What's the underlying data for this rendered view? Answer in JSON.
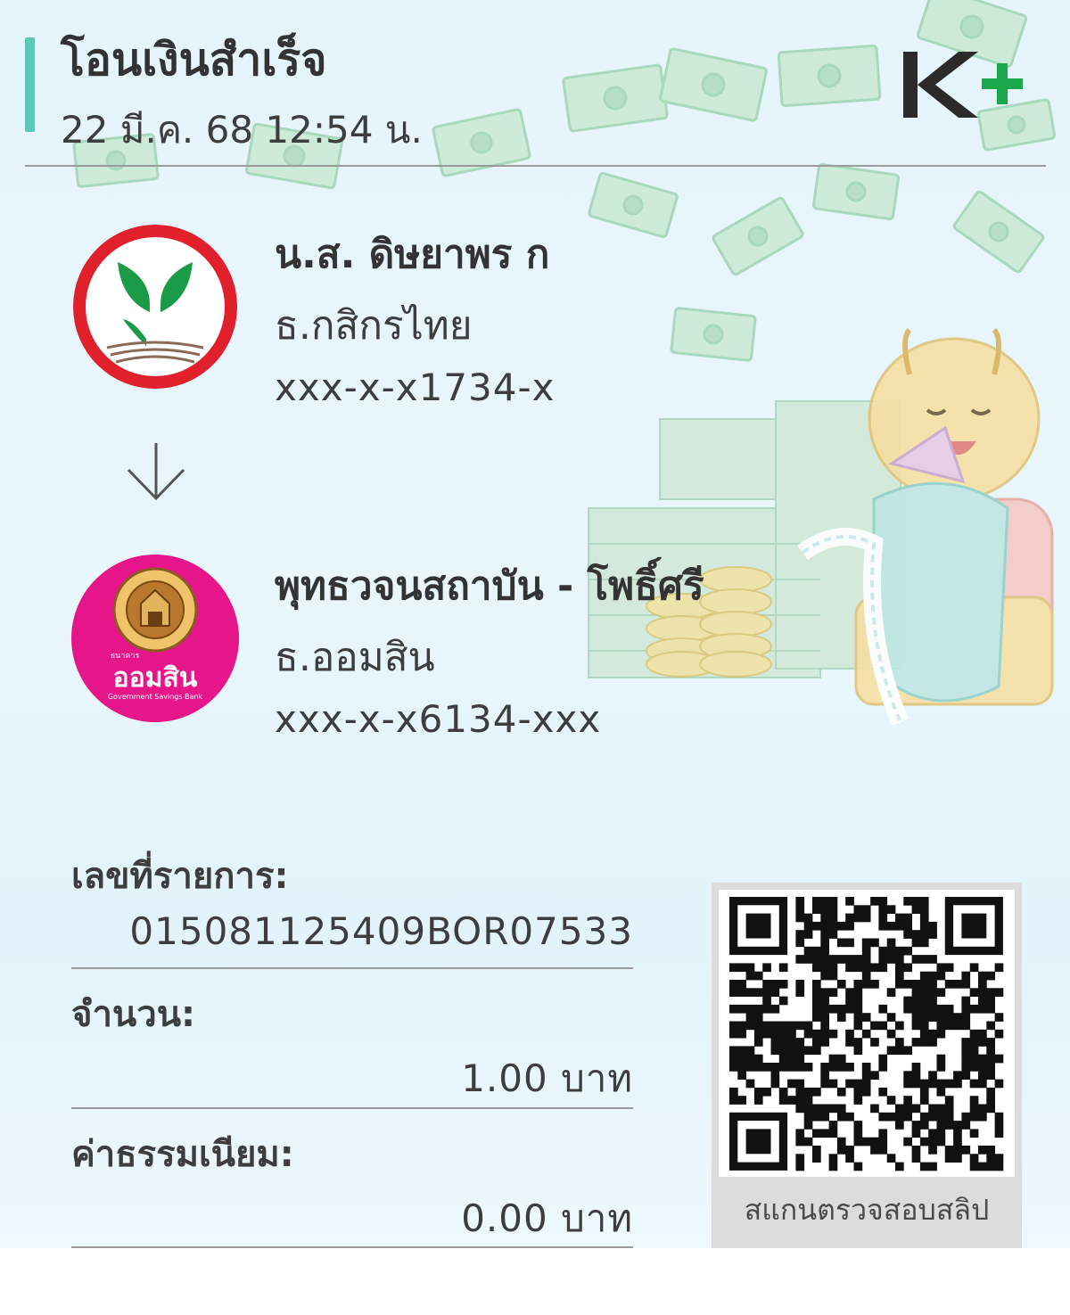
{
  "header": {
    "title": "โอนเงินสำเร็จ",
    "datetime": "22 มี.ค. 68  12:54 น.",
    "app_logo": "K+"
  },
  "sender": {
    "name": "น.ส. ดิษยาพร ก",
    "bank": "ธ.กสิกรไทย",
    "account": "xxx-x-x1734-x",
    "logo_icon": "kasikorn-bank-logo"
  },
  "receiver": {
    "name": "พุทธวจนสถาบัน - โพธิ์ศรี",
    "bank": "ธ.ออมสิน",
    "account": "xxx-x-x6134-xxx",
    "logo_icon": "gsb-logo",
    "logo_text": "ออมสิน",
    "logo_small_text": "ธนาคาร",
    "logo_en_text": "Government Savings Bank"
  },
  "details": {
    "ref_label": "เลขที่รายการ:",
    "ref_value": "015081125409BOR07533",
    "amount_label": "จำนวน:",
    "amount_value": "1.00 บาท",
    "fee_label": "ค่าธรรมเนียม:",
    "fee_value": "0.00 บาท"
  },
  "qr": {
    "caption": "สแกนตรวจสอบสลิป"
  },
  "colors": {
    "accent": "#5cc9b8",
    "kbank_green": "#1a9b48",
    "kbank_red": "#e0202a",
    "gsb_pink": "#e6158a",
    "kplus_green": "#1aa84b"
  }
}
